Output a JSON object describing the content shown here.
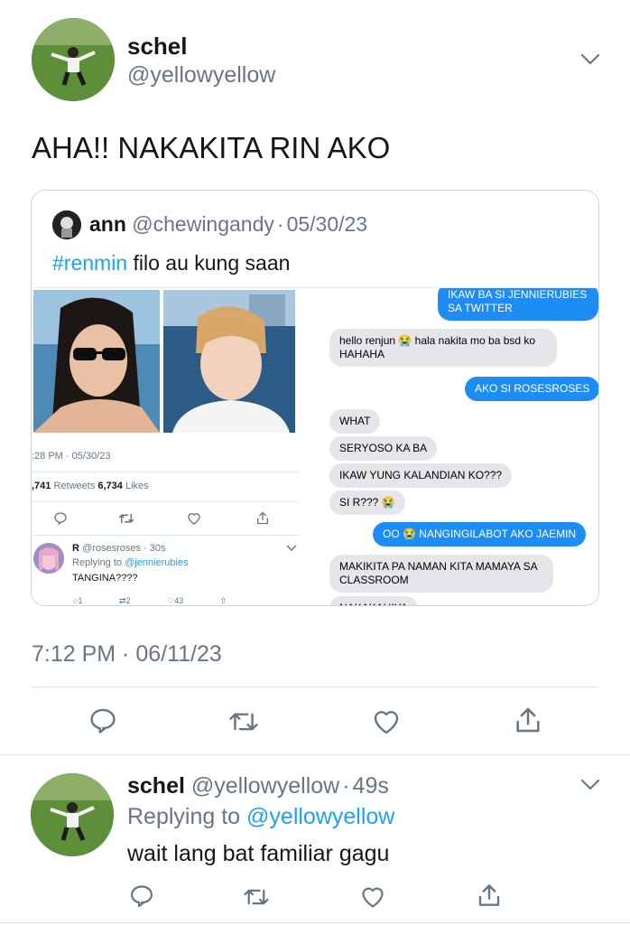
{
  "tweet": {
    "name": "schel",
    "handle": "@yellowyellow",
    "text": "AHA!! NAKAKITA RIN AKO",
    "timestamp": "7:12 PM · 06/11/23"
  },
  "quote": {
    "name": "ann",
    "handle": "@chewingandy",
    "sep": "·",
    "date": "05/30/23",
    "hashtag": "#renmin",
    "text": " filo au kung saan",
    "inner": {
      "time": ":28 PM · 05/30/23",
      "retweets_count": ",741",
      "retweets_label": " Retweets ",
      "likes_count": "6,734",
      "likes_label": " Likes",
      "reply_name": "R",
      "reply_handle": "@rosesroses · 30s",
      "reply_to_prefix": "Replying to ",
      "reply_to_handle": "@jennierubies",
      "reply_text": "TANGINA????",
      "reply_count": "1",
      "rt_count": "2",
      "like_count": "43"
    },
    "chat": {
      "r1": "IKAW BA SI JENNIERUBIES SA TWITTER",
      "l1": "hello renjun 😭 hala nakita mo ba bsd ko HAHAHA",
      "r2": "AKO SI ROSESROSES",
      "l2": "WHAT",
      "l3": "SERYOSO KA BA",
      "l4": "IKAW YUNG KALANDIAN KO???",
      "l5": "SI R??? 😭",
      "r3": "OO 😭 NANGINGILABOT AKO JAEMIN",
      "l6": "MAKIKITA PA NAMAN KITA MAMAYA SA CLASSROOM",
      "l7": "NAKAKAHIYA"
    }
  },
  "reply": {
    "name": "schel",
    "handle": "@yellowyellow",
    "sep": "·",
    "age": "49s",
    "replying_prefix": "Replying to ",
    "replying_handle": "@yellowyellow",
    "text": "wait lang bat familiar gagu"
  },
  "colors": {
    "accent": "#1da1f2",
    "imessage_blue": "#1e8cf5",
    "gray_text": "#657786"
  },
  "icons": [
    "chevron-down-icon",
    "reply-icon",
    "retweet-icon",
    "like-icon",
    "share-icon"
  ]
}
